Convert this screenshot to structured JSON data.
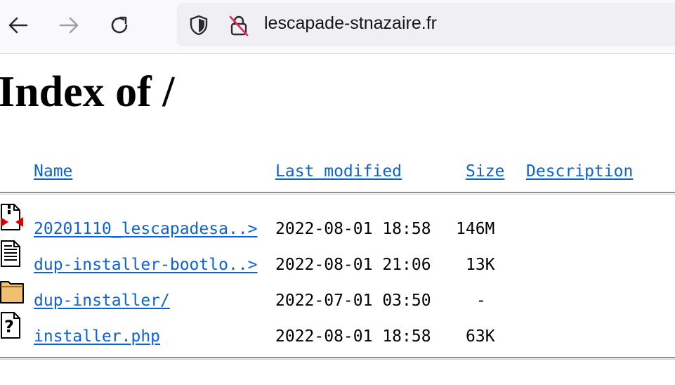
{
  "browser": {
    "url": "lescapade-stnazaire.fr"
  },
  "page": {
    "title": "Index of /",
    "columns": {
      "name": "Name",
      "last_modified": "Last modified",
      "size": "Size",
      "description": "Description"
    },
    "rows": [
      {
        "name": "20201110_lescapadesa..>",
        "modified": "2022-08-01 18:58",
        "size": "146M",
        "icon": "archive-icon"
      },
      {
        "name": "dup-installer-bootlo..>",
        "modified": "2022-08-01 21:06",
        "size": "13K",
        "icon": "text-file-icon"
      },
      {
        "name": "dup-installer/",
        "modified": "2022-07-01 03:50",
        "size": "-",
        "icon": "folder-icon"
      },
      {
        "name": "installer.php",
        "modified": "2022-08-01 18:58",
        "size": "63K",
        "icon": "unknown-file-icon"
      }
    ]
  }
}
